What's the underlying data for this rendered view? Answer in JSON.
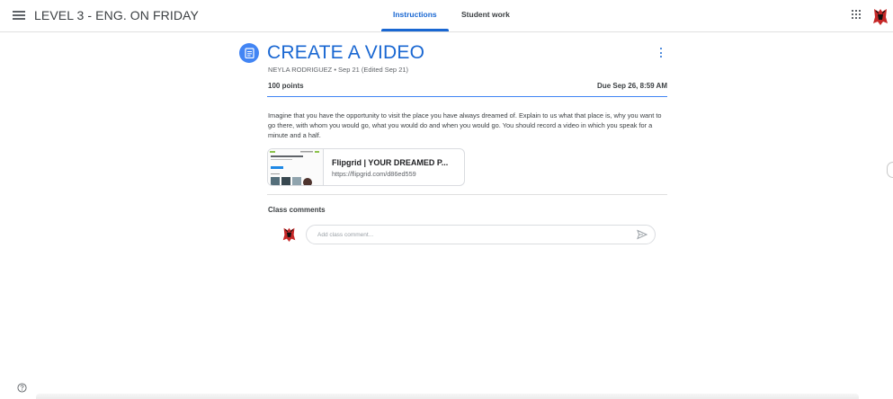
{
  "header": {
    "class_title": "LEVEL 3 - ENG. ON FRIDAY",
    "menu_icon": "hamburger-menu-icon",
    "apps_icon": "apps-grid-icon",
    "tabs": [
      {
        "label": "Instructions",
        "active": true
      },
      {
        "label": "Student work",
        "active": false
      }
    ],
    "accent_color": "#1967d2"
  },
  "assignment": {
    "icon": "assignment-icon",
    "title": "CREATE A VIDEO",
    "meta": "NEYLA RODRIGUEZ • Sep 21 (Edited Sep 21)",
    "points": "100 points",
    "due": "Due Sep 26, 8:59 AM",
    "description": "Imagine that you have the opportunity to visit the place you have always dreamed of. Explain to us what that place is, why you want to go there, with whom you would go, what you would do and when you would go. You should record a video in which you speak for a minute and a half."
  },
  "attachment": {
    "title": "Flipgrid | YOUR DREAMED P...",
    "url": "https://flipgrid.com/d86ed559",
    "thumbnail_icon": "flipgrid-thumbnail"
  },
  "comments": {
    "label": "Class comments",
    "placeholder": "Add class comment...",
    "send_icon": "send-icon"
  },
  "footer": {
    "help_icon": "help-icon"
  }
}
